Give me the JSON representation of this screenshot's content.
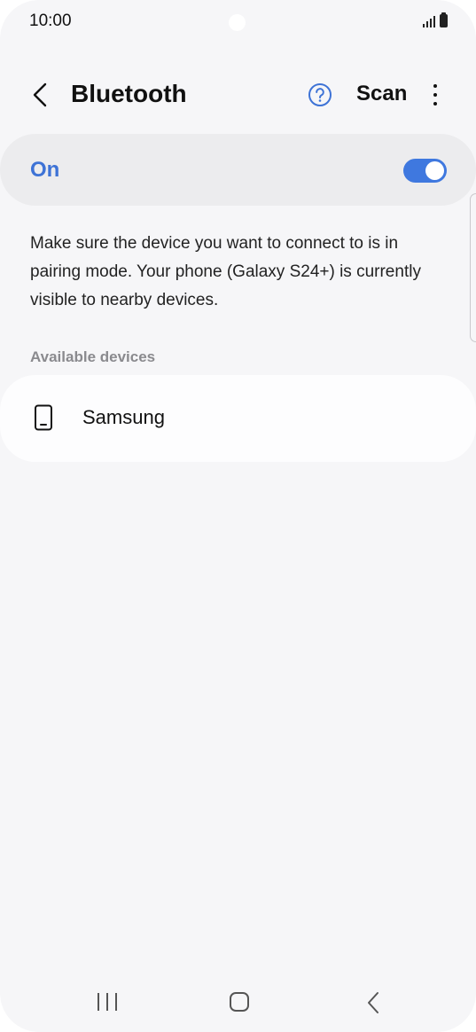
{
  "status_bar": {
    "time": "10:00",
    "icons": [
      "signal-icon",
      "battery-icon"
    ]
  },
  "header": {
    "back_icon": "chevron-left-icon",
    "title": "Bluetooth",
    "help_icon": "help-circle-icon",
    "scan_label": "Scan",
    "more_icon": "more-vertical-icon"
  },
  "bluetooth_toggle": {
    "label": "On",
    "state": true
  },
  "description": "Make sure the device you want to connect to is in pairing mode. Your phone (Galaxy S24+) is currently visible to nearby devices.",
  "available_devices": {
    "header": "Available devices",
    "items": [
      {
        "name": "Samsung",
        "icon": "smartphone-icon"
      }
    ]
  },
  "nav_bar": {
    "icons": [
      "recent-apps-icon",
      "home-icon",
      "back-icon"
    ]
  },
  "colors": {
    "accent": "#3f78df",
    "accent_text": "#3e73d6",
    "background": "#f6f6f8",
    "card": "#ececee",
    "secondary_text": "#8a8a8e"
  }
}
